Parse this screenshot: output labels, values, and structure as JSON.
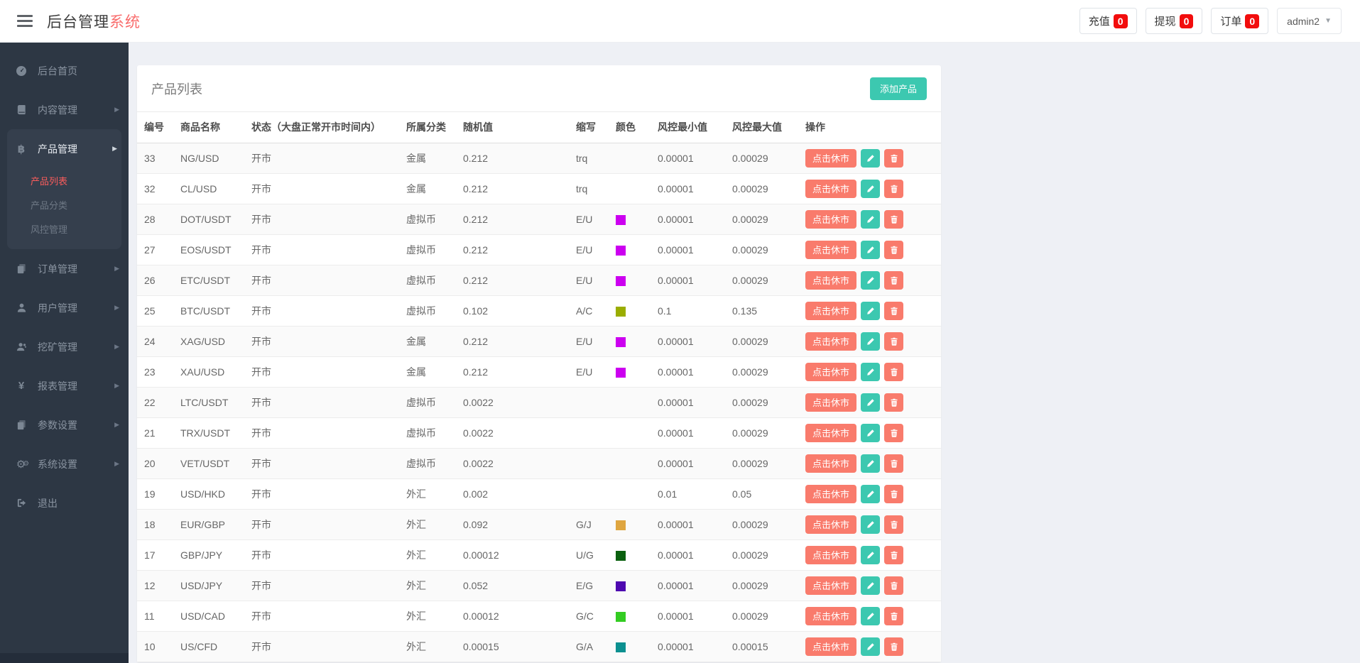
{
  "app": {
    "title_primary": "后台管理",
    "title_accent": "系统"
  },
  "navbar": {
    "stats": [
      {
        "label": "充值",
        "count": "0"
      },
      {
        "label": "提现",
        "count": "0"
      },
      {
        "label": "订单",
        "count": "0"
      }
    ],
    "user": {
      "name": "admin2"
    }
  },
  "sidebar": {
    "items": [
      {
        "label": "后台首页",
        "icon": "dashboard-icon",
        "has_children": false
      },
      {
        "label": "内容管理",
        "icon": "book-icon",
        "has_children": true
      },
      {
        "label": "产品管理",
        "icon": "bitcoin-icon",
        "has_children": true,
        "active": true,
        "children": [
          {
            "label": "产品列表",
            "active": true
          },
          {
            "label": "产品分类",
            "active": false
          },
          {
            "label": "风控管理",
            "active": false
          }
        ]
      },
      {
        "label": "订单管理",
        "icon": "copy-icon",
        "has_children": true
      },
      {
        "label": "用户管理",
        "icon": "user-icon",
        "has_children": true
      },
      {
        "label": "挖矿管理",
        "icon": "miner-icon",
        "has_children": true
      },
      {
        "label": "报表管理",
        "icon": "yen-icon",
        "has_children": true
      },
      {
        "label": "参数设置",
        "icon": "copy-icon",
        "has_children": true
      },
      {
        "label": "系统设置",
        "icon": "gears-icon",
        "has_children": true
      },
      {
        "label": "退出",
        "icon": "signout-icon",
        "has_children": false
      }
    ]
  },
  "page": {
    "title": "产品列表",
    "add_button": "添加产品"
  },
  "table": {
    "columns": [
      "编号",
      "商品名称",
      "状态（大盘正常开市时间内）",
      "所属分类",
      "随机值",
      "缩写",
      "颜色",
      "风控最小值",
      "风控最大值",
      "操作"
    ],
    "action_labels": {
      "close_market": "点击休市"
    },
    "rows": [
      {
        "id": "33",
        "name": "NG/USD",
        "status": "开市",
        "category": "金属",
        "random": "0.212",
        "abbr": "trq",
        "color": null,
        "min": "0.00001",
        "max": "0.00029"
      },
      {
        "id": "32",
        "name": "CL/USD",
        "status": "开市",
        "category": "金属",
        "random": "0.212",
        "abbr": "trq",
        "color": null,
        "min": "0.00001",
        "max": "0.00029"
      },
      {
        "id": "28",
        "name": "DOT/USDT",
        "status": "开市",
        "category": "虚拟币",
        "random": "0.212",
        "abbr": "E/U",
        "color": "#cc00f0",
        "min": "0.00001",
        "max": "0.00029"
      },
      {
        "id": "27",
        "name": "EOS/USDT",
        "status": "开市",
        "category": "虚拟币",
        "random": "0.212",
        "abbr": "E/U",
        "color": "#cc00f0",
        "min": "0.00001",
        "max": "0.00029"
      },
      {
        "id": "26",
        "name": "ETC/USDT",
        "status": "开市",
        "category": "虚拟币",
        "random": "0.212",
        "abbr": "E/U",
        "color": "#cc00f0",
        "min": "0.00001",
        "max": "0.00029"
      },
      {
        "id": "25",
        "name": "BTC/USDT",
        "status": "开市",
        "category": "虚拟币",
        "random": "0.102",
        "abbr": "A/C",
        "color": "#9aad00",
        "min": "0.1",
        "max": "0.135"
      },
      {
        "id": "24",
        "name": "XAG/USD",
        "status": "开市",
        "category": "金属",
        "random": "0.212",
        "abbr": "E/U",
        "color": "#cc00f0",
        "min": "0.00001",
        "max": "0.00029"
      },
      {
        "id": "23",
        "name": "XAU/USD",
        "status": "开市",
        "category": "金属",
        "random": "0.212",
        "abbr": "E/U",
        "color": "#cc00f0",
        "min": "0.00001",
        "max": "0.00029"
      },
      {
        "id": "22",
        "name": "LTC/USDT",
        "status": "开市",
        "category": "虚拟币",
        "random": "0.0022",
        "abbr": "",
        "color": null,
        "min": "0.00001",
        "max": "0.00029"
      },
      {
        "id": "21",
        "name": "TRX/USDT",
        "status": "开市",
        "category": "虚拟币",
        "random": "0.0022",
        "abbr": "",
        "color": null,
        "min": "0.00001",
        "max": "0.00029"
      },
      {
        "id": "20",
        "name": "VET/USDT",
        "status": "开市",
        "category": "虚拟币",
        "random": "0.0022",
        "abbr": "",
        "color": null,
        "min": "0.00001",
        "max": "0.00029"
      },
      {
        "id": "19",
        "name": "USD/HKD",
        "status": "开市",
        "category": "外汇",
        "random": "0.002",
        "abbr": "",
        "color": null,
        "min": "0.01",
        "max": "0.05"
      },
      {
        "id": "18",
        "name": "EUR/GBP",
        "status": "开市",
        "category": "外汇",
        "random": "0.092",
        "abbr": "G/J",
        "color": "#dfa640",
        "min": "0.00001",
        "max": "0.00029"
      },
      {
        "id": "17",
        "name": "GBP/JPY",
        "status": "开市",
        "category": "外汇",
        "random": "0.00012",
        "abbr": "U/G",
        "color": "#0a600f",
        "min": "0.00001",
        "max": "0.00029"
      },
      {
        "id": "12",
        "name": "USD/JPY",
        "status": "开市",
        "category": "外汇",
        "random": "0.052",
        "abbr": "E/G",
        "color": "#4e09b0",
        "min": "0.00001",
        "max": "0.00029"
      },
      {
        "id": "11",
        "name": "USD/CAD",
        "status": "开市",
        "category": "外汇",
        "random": "0.00012",
        "abbr": "G/C",
        "color": "#33cc22",
        "min": "0.00001",
        "max": "0.00029"
      },
      {
        "id": "10",
        "name": "US/CFD",
        "status": "开市",
        "category": "外汇",
        "random": "0.00015",
        "abbr": "G/A",
        "color": "#0c9090",
        "min": "0.00001",
        "max": "0.00015"
      }
    ]
  },
  "colors": {
    "accent_red": "#f96c6c",
    "badge_red": "#f20d0d",
    "teal": "#3cc8b0",
    "salmon": "#f97b6c",
    "sidebar_bg": "#2d3744"
  }
}
